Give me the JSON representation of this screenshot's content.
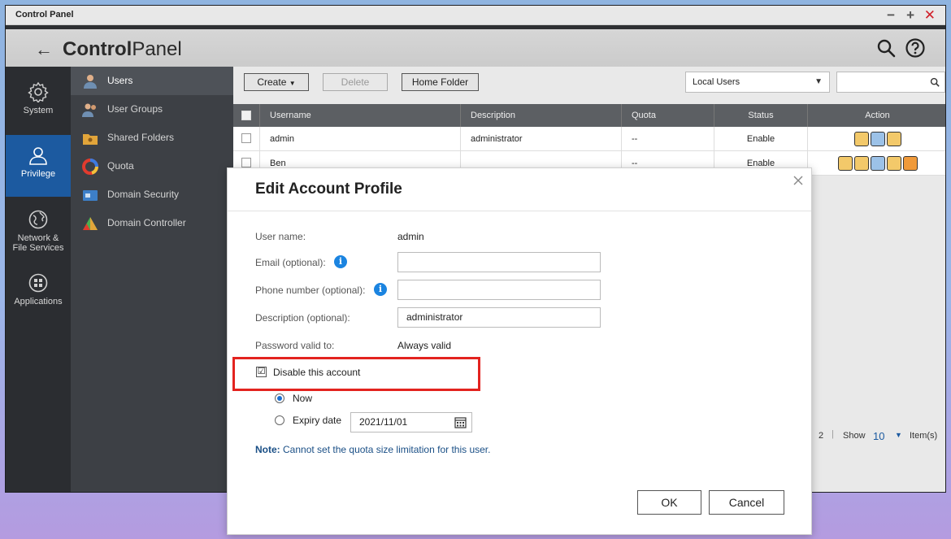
{
  "window": {
    "title": "Control Panel",
    "controls": {
      "minimize": "−",
      "maximize": "+",
      "close": "✕"
    }
  },
  "header": {
    "back_icon": "←",
    "title_bold": "Control",
    "title_rest": "Panel",
    "icons": [
      "search-icon",
      "help-icon"
    ]
  },
  "leftnav": {
    "items": [
      {
        "label": "System",
        "icon": "gear-icon",
        "active": false
      },
      {
        "label": "Privilege",
        "icon": "user-icon",
        "active": true
      },
      {
        "label_line1": "Network &",
        "label_line2": "File Services",
        "icon": "globe-icon",
        "active": false
      },
      {
        "label": "Applications",
        "icon": "apps-icon",
        "active": false
      }
    ]
  },
  "subnav": {
    "items": [
      {
        "label": "Users",
        "active": true
      },
      {
        "label": "User Groups",
        "active": false
      },
      {
        "label": "Shared Folders",
        "active": false
      },
      {
        "label": "Quota",
        "active": false
      },
      {
        "label": "Domain Security",
        "active": false
      },
      {
        "label": "Domain Controller",
        "active": false
      }
    ]
  },
  "toolbar": {
    "create_label": "Create",
    "delete_label": "Delete",
    "home_folder_label": "Home Folder",
    "user_type_selected": "Local Users"
  },
  "table": {
    "headers": [
      "Username",
      "Description",
      "Quota",
      "Status",
      "Action"
    ],
    "rows": [
      {
        "username": "admin",
        "description": "administrator",
        "quota": "--",
        "status": "Enable"
      },
      {
        "username": "Ben",
        "description": "",
        "quota": "--",
        "status": "Enable"
      }
    ]
  },
  "pager": {
    "page": "2",
    "show_label": "Show",
    "show_value": "10",
    "items_label": "Item(s)"
  },
  "dialog": {
    "title": "Edit Account Profile",
    "fields": {
      "username_label": "User name:",
      "username_value": "admin",
      "email_label": "Email (optional):",
      "email_value": "",
      "phone_label": "Phone number (optional):",
      "phone_value": "",
      "description_label": "Description (optional):",
      "description_value": "administrator",
      "password_label": "Password valid to:",
      "password_value": "Always valid"
    },
    "disable_label": "Disable this account",
    "disable_checked": "☑",
    "now_label": "Now",
    "expiry_label": "Expiry date",
    "expiry_value": "2021/11/01",
    "note_prefix": "Note:",
    "note_text": " Cannot set the quota size limitation for this user.",
    "ok_label": "OK",
    "cancel_label": "Cancel",
    "highlight_color": "#e3231f"
  },
  "colors": {
    "accent": "#1c5aa0",
    "info": "#1b84e0",
    "close": "#d0202a"
  }
}
